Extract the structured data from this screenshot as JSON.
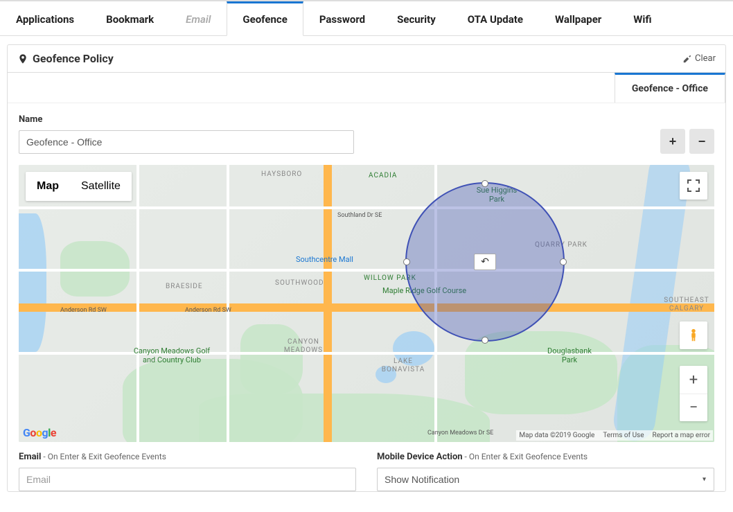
{
  "tabs": [
    {
      "label": "Applications"
    },
    {
      "label": "Bookmark"
    },
    {
      "label": "Email",
      "disabled": true
    },
    {
      "label": "Geofence",
      "active": true
    },
    {
      "label": "Password"
    },
    {
      "label": "Security"
    },
    {
      "label": "OTA Update"
    },
    {
      "label": "Wallpaper"
    },
    {
      "label": "Wifi"
    }
  ],
  "panel": {
    "title": "Geofence Policy",
    "clear": "Clear"
  },
  "subtab": "Geofence - Office",
  "form": {
    "name_label": "Name",
    "name_value": "Geofence - Office",
    "add_label": "+",
    "remove_label": "−"
  },
  "map": {
    "map_btn": "Map",
    "satellite_btn": "Satellite",
    "zoom_in": "+",
    "zoom_out": "−",
    "attribution": "Map data ©2019 Google",
    "terms": "Terms of Use",
    "report": "Report a map error",
    "brand": "Google",
    "poi": {
      "southcentre": "Southcentre Mall",
      "mapleridge": "Maple Ridge Golf Course",
      "canyon": "Canyon Meadows Golf and Country Club",
      "suehiggins": "Sue Higgins Park",
      "douglasbank": "Douglasbank Park",
      "haysboro": "HAYSBORO",
      "acadia": "ACADIA",
      "braeside": "BRAESIDE",
      "southwood": "SOUTHWOOD",
      "willowpark": "WILLOW PARK",
      "quarry": "QUARRY PARK",
      "canyonmeadows": "CANYON MEADOWS",
      "lakebon": "LAKE BONAVISTA",
      "secalg": "SOUTHEAST CALGARY",
      "southland": "Southland Dr SE",
      "anderson": "Anderson Rd SW",
      "anderson2": "Anderson Rd SW",
      "cmdr": "Canyon Meadows Dr SE"
    }
  },
  "bottom": {
    "email_label": "Email",
    "email_sub": " - On Enter & Exit Geofence Events",
    "email_placeholder": "Email",
    "action_label": "Mobile Device Action",
    "action_sub": " - On Enter & Exit Geofence Events",
    "action_value": "Show Notification"
  }
}
